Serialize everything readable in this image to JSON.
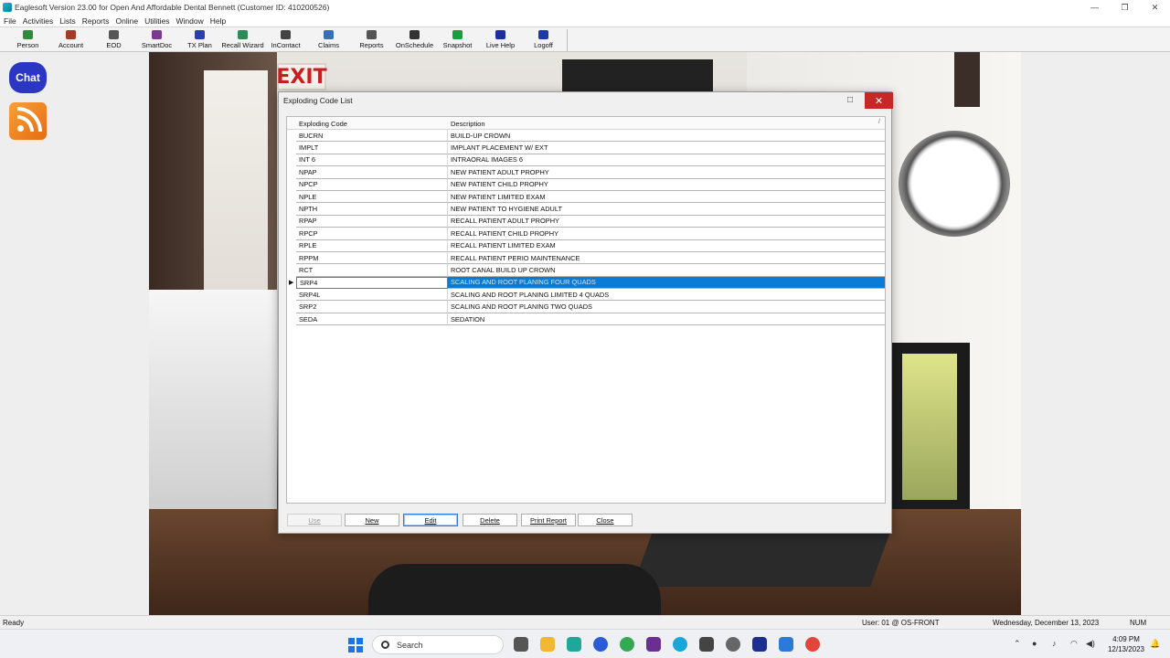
{
  "window": {
    "title": "Eaglesoft Version 23.00 for Open And Affordable Dental Bennett (Customer ID: 410200526)",
    "controls": {
      "minimize": "—",
      "restore": "❐",
      "close": "✕"
    }
  },
  "menu": [
    "File",
    "Activities",
    "Lists",
    "Reports",
    "Online",
    "Utilities",
    "Window",
    "Help"
  ],
  "toolbar": [
    {
      "label": "Person",
      "color": "#2e8b3a"
    },
    {
      "label": "Account",
      "color": "#a33a2a"
    },
    {
      "label": "EOD",
      "color": "#555555"
    },
    {
      "label": "SmartDoc",
      "color": "#7a3b8f"
    },
    {
      "label": "TX Plan",
      "color": "#2b3fa8"
    },
    {
      "label": "Recall Wizard",
      "color": "#2e8b57"
    },
    {
      "label": "InContact",
      "color": "#444444"
    },
    {
      "label": "Claims",
      "color": "#3b6fb5"
    },
    {
      "label": "Reports",
      "color": "#555555"
    },
    {
      "label": "OnSchedule",
      "color": "#333333"
    },
    {
      "label": "Snapshot",
      "color": "#1e9b3e"
    },
    {
      "label": "Live Help",
      "color": "#1c2fa0"
    },
    {
      "label": "Logoff",
      "color": "#1a3aa8"
    }
  ],
  "desktop": {
    "chat_label": "Chat",
    "exit_sign": "EXIT"
  },
  "dialog": {
    "title": "Exploding Code List",
    "columns": {
      "code": "Exploding Code",
      "description": "Description",
      "sort_indicator": "/"
    },
    "rows": [
      {
        "code": "BUCRN",
        "description": "BUILD-UP CROWN"
      },
      {
        "code": "IMPLT",
        "description": "IMPLANT PLACEMENT W/ EXT"
      },
      {
        "code": "INT 6",
        "description": "INTRAORAL IMAGES 6"
      },
      {
        "code": "NPAP",
        "description": "NEW PATIENT ADULT PROPHY"
      },
      {
        "code": "NPCP",
        "description": "NEW PATIENT CHILD PROPHY"
      },
      {
        "code": "NPLE",
        "description": "NEW PATIENT LIMITED EXAM"
      },
      {
        "code": "NPTH",
        "description": "NEW PATIENT TO HYGIENE ADULT"
      },
      {
        "code": "RPAP",
        "description": "RECALL PATIENT ADULT PROPHY"
      },
      {
        "code": "RPCP",
        "description": "RECALL PATIENT CHILD PROPHY"
      },
      {
        "code": "RPLE",
        "description": "RECALL PATIENT LIMITED EXAM"
      },
      {
        "code": "RPPM",
        "description": "RECALL PATIENT PERIO MAINTENANCE"
      },
      {
        "code": "RCT",
        "description": "ROOT CANAL BUILD UP CROWN"
      },
      {
        "code": "SRP4",
        "description": "SCALING AND ROOT PLANING FOUR QUADS",
        "selected": true
      },
      {
        "code": "SRP4L",
        "description": "SCALING AND ROOT PLANING LIMITED 4 QUADS"
      },
      {
        "code": "SRP2",
        "description": "SCALING AND ROOT PLANING TWO QUADS"
      },
      {
        "code": "SEDA",
        "description": "SEDATION"
      }
    ],
    "buttons": {
      "use": "Use",
      "new": "New",
      "edit": "Edit",
      "delete": "Delete",
      "print_report": "Print Report",
      "close": "Close"
    }
  },
  "statusbar": {
    "status": "Ready",
    "user": "User: 01 @ OS-FRONT",
    "date": "Wednesday, December 13, 2023",
    "numlock": "NUM"
  },
  "taskbar": {
    "search_placeholder": "Search",
    "time": "4:09 PM",
    "date": "12/13/2023",
    "tray_icons": [
      "chevron-up-icon",
      "wifi-icon",
      "speaker-icon"
    ]
  }
}
